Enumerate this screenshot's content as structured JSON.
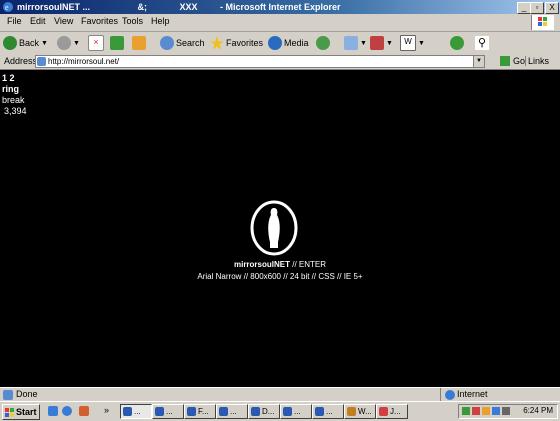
{
  "window": {
    "title": "mirrorsoulNET ...                   &;             XXX         - Microsoft Internet Explorer",
    "controls": [
      "_",
      "▫",
      "X"
    ]
  },
  "menubar": [
    "File",
    "Edit",
    "View",
    "Favorites",
    "Tools",
    "Help"
  ],
  "toolbar": {
    "back": "Back",
    "search": "Search",
    "favorites": "Favorites",
    "media": "Media"
  },
  "address": {
    "label": "Address",
    "url": "http://mirrorsoul.net/",
    "go": "Go",
    "links": "Links"
  },
  "page": {
    "side_lines": [
      "1 2",
      "ring",
      "break",
      "3,394"
    ],
    "title_brand": "mirrorsoulNET",
    "title_suffix": " // ENTER",
    "info": "Arial Narrow // 800x600 // 24 bit // CSS // IE 5+"
  },
  "status": {
    "text": "Done",
    "zone": "Internet"
  },
  "taskbar": {
    "start": "Start",
    "quicklaunch_more": "»",
    "tasks": [
      "...",
      "...",
      "F...",
      "...",
      "D...",
      "...",
      "...",
      "W...",
      "J..."
    ],
    "clock": "6:24 PM"
  }
}
